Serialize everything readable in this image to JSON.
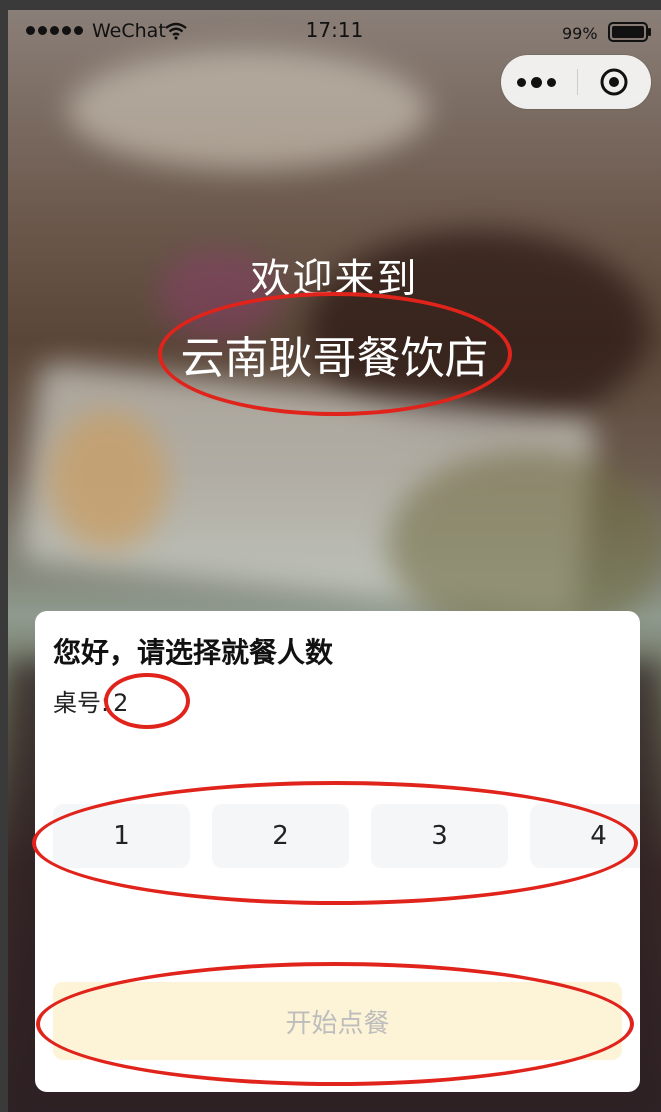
{
  "status_bar": {
    "carrier": "WeChat",
    "time": "17:11",
    "battery": "99%"
  },
  "welcome": {
    "line": "欢迎来到",
    "restaurant_name": "云南耿哥餐饮店"
  },
  "card": {
    "title": "您好，请选择就餐人数",
    "table_label": "桌号:",
    "table_number": "2",
    "count_options": [
      "1",
      "2",
      "3",
      "4"
    ],
    "start_button": "开始点餐"
  },
  "colors": {
    "annotation": "#e0231b",
    "start_button_bg": "#fdf3d6",
    "option_bg": "#f5f6f8"
  }
}
